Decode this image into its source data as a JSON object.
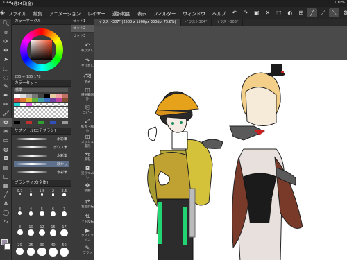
{
  "status": {
    "time": "1:44",
    "date": "4月14日(金)",
    "battery": "100%"
  },
  "menu": [
    "ファイル",
    "編集",
    "アニメーション",
    "レイヤー",
    "選択範囲",
    "表示",
    "フィルター",
    "ウィンドウ",
    "ヘルプ"
  ],
  "panels": {
    "color_wheel_title": "カラーサークル",
    "color_values": "205 ← 185 178",
    "color_set_title": "カラーセット",
    "color_set_name": "標準",
    "subtool_title": "サブツール[エアブラシ]",
    "brushes": [
      "水彩筆",
      "ガウス筆",
      "水彩筆",
      "ぼかし",
      "水彩筆"
    ],
    "brush_size_title": "ブラシサイズ[全体]",
    "sizes": [
      "0.7",
      "1",
      "1.5",
      "2",
      "2.5",
      "3",
      "4",
      "5",
      "6",
      "7",
      "8",
      "10",
      "12",
      "15",
      "17",
      "20",
      "25",
      "30",
      "40",
      "50"
    ]
  },
  "sublist": {
    "head": "セット1",
    "items": [
      "セット2",
      "セット3"
    ],
    "actions": [
      "取り消し",
      "やり直し",
      "消去",
      "選択範囲外",
      "コピー",
      "拡大・縮小",
      "メッシュ変形",
      "反転",
      "塗りつぶし",
      "移動",
      "左右反転",
      "上下反転",
      "タイムライン",
      "ブラシ"
    ]
  },
  "tabs": [
    "イラスト307* (2500 x 1500px 350dpi 75.6%)",
    "イラスト304*",
    "イラスト303*"
  ]
}
